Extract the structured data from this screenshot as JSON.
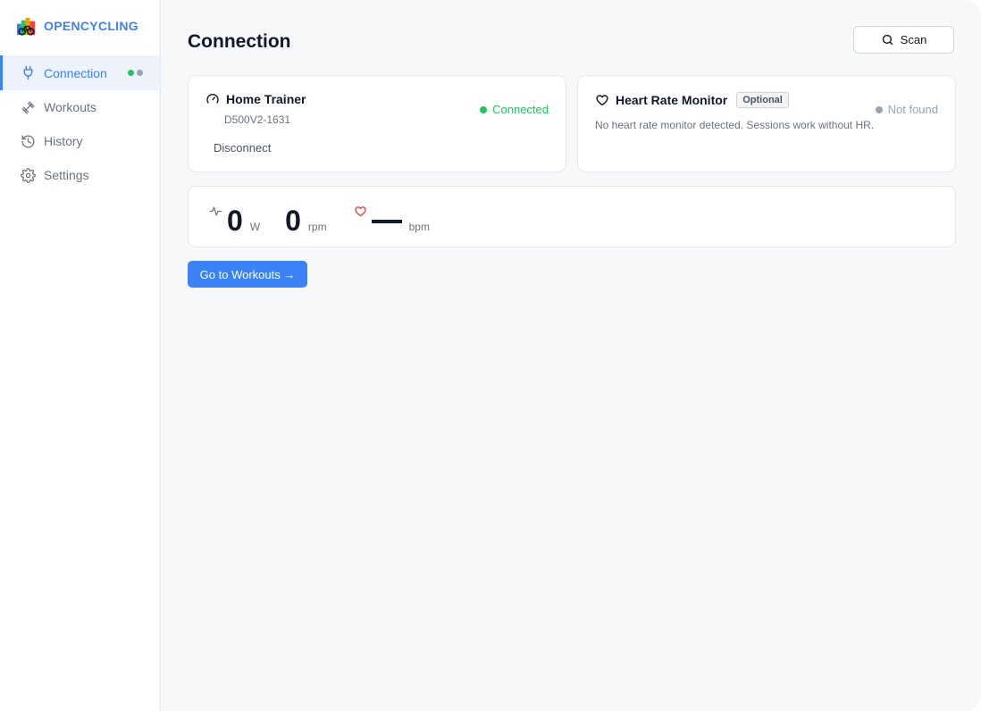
{
  "app": {
    "name": "OPENCYCLING",
    "brand_color": "#3b82f6"
  },
  "sidebar": {
    "items": [
      {
        "label": "Connection",
        "icon": "plug-icon",
        "active": true,
        "status_dots": [
          "#22c55e",
          "#9ca3af"
        ]
      },
      {
        "label": "Workouts",
        "icon": "dumbbell-icon",
        "active": false
      },
      {
        "label": "History",
        "icon": "history-icon",
        "active": false
      },
      {
        "label": "Settings",
        "icon": "gear-icon",
        "active": false
      }
    ]
  },
  "header": {
    "title": "Connection",
    "scan_label": "Scan"
  },
  "trainer": {
    "title": "Home Trainer",
    "device": "D500V2-1631",
    "status": "Connected",
    "status_color": "#22c55e",
    "action": "Disconnect",
    "icon": "gauge-icon"
  },
  "hr_monitor": {
    "title": "Heart Rate Monitor",
    "badge": "Optional",
    "status": "Not found",
    "status_color": "#9ca3af",
    "description": "No heart rate monitor detected. Sessions work without HR.",
    "icon": "heart-icon"
  },
  "metrics": {
    "power": {
      "value": "0",
      "unit": "W",
      "icon": "activity-icon"
    },
    "cadence": {
      "value": "0",
      "unit": "rpm"
    },
    "heart_rate": {
      "value": "—",
      "unit": "bpm",
      "icon": "heart-icon",
      "icon_color": "#ef4444"
    }
  },
  "cta": {
    "label": "Go to Workouts →"
  }
}
